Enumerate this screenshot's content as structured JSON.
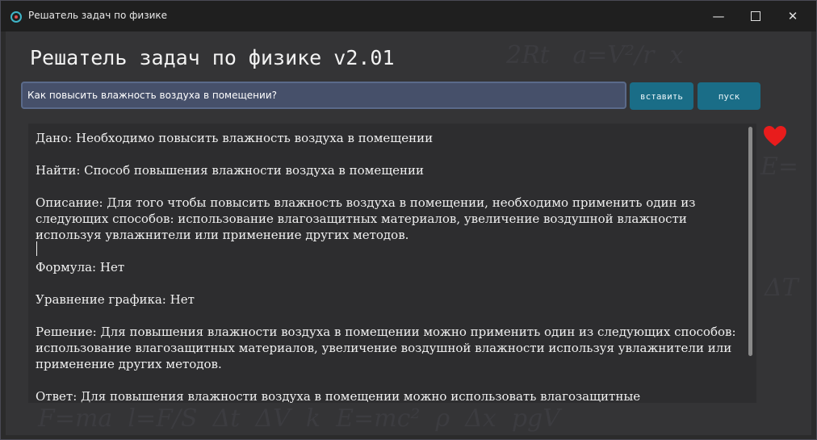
{
  "window": {
    "title": "Решатель задач по физике",
    "minimize_glyph": "—",
    "close_glyph": "✕"
  },
  "app": {
    "heading": "Решатель задач по физике v2.01"
  },
  "query": {
    "value": "Как повысить влажность воздуха в помещении?"
  },
  "buttons": {
    "insert_label": "вставить",
    "run_label": "пуск"
  },
  "answer": {
    "text": "Дано: Необходимо повысить влажность воздуха в помещении\n\nНайти: Способ повышения влажности воздуха в помещении\n\nОписание: Для того чтобы повысить влажность воздуха в помещении, необходимо применить один из следующих способов: использование влагозащитных материалов, увеличение воздушной влажности используя увлажнители или применение других методов.\n\nФормула: Нет\n\nУравнение графика: Нет\n\nРешение: Для повышения влажности воздуха в помещении можно применить один из следующих способов: использование влагозащитных материалов, увеличение воздушной влажности используя увлажнители или применение других методов.\n\nОтвет: Для повышения влажности воздуха в помещении можно использовать влагозащитные"
  },
  "icons": {
    "app": "physics-atom-icon",
    "favorite": "heart-icon"
  },
  "colors": {
    "button": "#1a6d87",
    "heart": "#e81c1c",
    "query_bg": "#46506a"
  }
}
